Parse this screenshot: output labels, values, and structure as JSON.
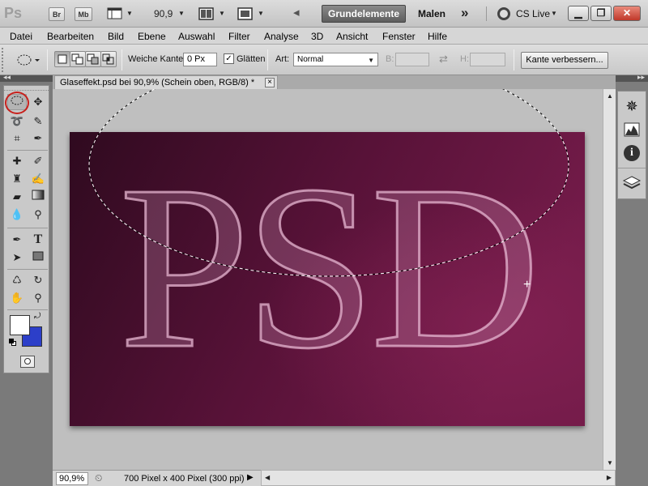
{
  "app": {
    "logo": "Ps"
  },
  "appbar": {
    "bridge_label": "Br",
    "minibridge_label": "Mb",
    "zoom_value": "90,9",
    "workspace_active": "Grundelemente",
    "workspace_other": "Malen",
    "more_label": "»",
    "cslive_label": "CS Live"
  },
  "menu": [
    "Datei",
    "Bearbeiten",
    "Bild",
    "Ebene",
    "Auswahl",
    "Filter",
    "Analyse",
    "3D",
    "Ansicht",
    "Fenster",
    "Hilfe"
  ],
  "options": {
    "feather_label": "Weiche Kante:",
    "feather_value": "0 Px",
    "antialias_label": "Glätten",
    "antialias_checked": true,
    "style_label": "Art:",
    "style_value": "Normal",
    "width_label": "B:",
    "height_label": "H:",
    "refine_label": "Kante verbessern..."
  },
  "document": {
    "tab_title": "Glaseffekt.psd bei 90,9% (Schein oben, RGB/8) *",
    "close_glyph": "×",
    "canvas_text": "PSD",
    "background_colors": [
      "#2f0a1f",
      "#581238",
      "#731b49"
    ],
    "text_color": "#d6a4bf"
  },
  "status": {
    "zoom": "90,9%",
    "doc_info": "700 Pixel x 400 Pixel (300 ppi)"
  },
  "tools": [
    "elliptical-marquee-tool",
    "move-tool",
    "lasso-tool",
    "quick-selection-tool",
    "crop-tool",
    "eyedropper-tool",
    "spot-healing-brush-tool",
    "brush-tool",
    "clone-stamp-tool",
    "history-brush-tool",
    "eraser-tool",
    "gradient-tool",
    "blur-tool",
    "dodge-tool",
    "pen-tool",
    "type-tool",
    "path-selection-tool",
    "rectangle-tool",
    "3d-rotate-tool",
    "3d-orbit-tool",
    "hand-tool",
    "zoom-tool"
  ],
  "colors": {
    "foreground": "#ffffff",
    "background": "#2c3fc9",
    "highlight_circle": "#c8201c"
  },
  "right_panel": [
    "navigator-icon",
    "histogram-icon",
    "info-icon",
    "layers-icon"
  ]
}
